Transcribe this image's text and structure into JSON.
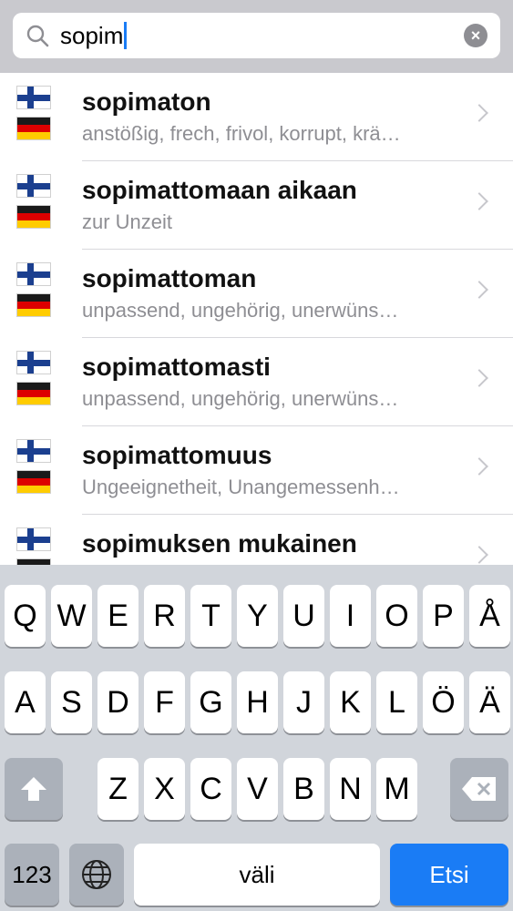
{
  "search": {
    "query": "sopim",
    "clear_label": "×"
  },
  "results": [
    {
      "word": "sopimaton",
      "translation": "anstößig, frech, frivol, korrupt, krä…"
    },
    {
      "word": "sopimattomaan aikaan",
      "translation": "zur Unzeit"
    },
    {
      "word": "sopimattoman",
      "translation": "unpassend, ungehörig, unerwüns…"
    },
    {
      "word": "sopimattomasti",
      "translation": "unpassend, ungehörig, unerwüns…"
    },
    {
      "word": "sopimattomuus",
      "translation": "Ungeeignetheit, Unangemessenh…"
    },
    {
      "word": "sopimuksen mukainen",
      "translation": ""
    }
  ],
  "keyboard": {
    "row1": [
      "Q",
      "W",
      "E",
      "R",
      "T",
      "Y",
      "U",
      "I",
      "O",
      "P",
      "Å"
    ],
    "row2": [
      "A",
      "S",
      "D",
      "F",
      "G",
      "H",
      "J",
      "K",
      "L",
      "Ö",
      "Ä"
    ],
    "row3": [
      "Z",
      "X",
      "C",
      "V",
      "B",
      "N",
      "M"
    ],
    "numbers_label": "123",
    "space_label": "väli",
    "search_label": "Etsi"
  },
  "colors": {
    "accent": "#1a7cf5",
    "keyboard_bg": "#d1d5db"
  }
}
